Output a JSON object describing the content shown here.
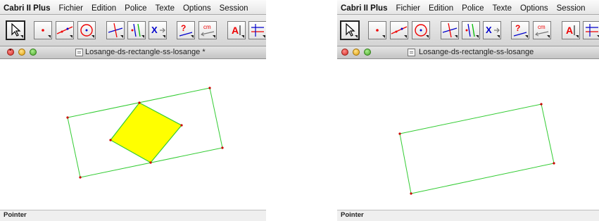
{
  "menubar": {
    "app": "Cabri II Plus",
    "left_items": [
      "Fichier",
      "Edition",
      "Police",
      "Texte",
      "Options",
      "Session"
    ],
    "right_items": [
      "Fichier",
      "Edition",
      "Police",
      "Texte",
      "Options",
      "Session"
    ]
  },
  "windows": {
    "left_title": "Losange-ds-rectangle-ss-losange *",
    "right_title": "Losange-ds-rectangle-ss-losange"
  },
  "status": {
    "left": "Pointer",
    "right": "Pointer"
  },
  "tools": [
    {
      "name": "pointer-tool-button",
      "icon": "pointer-arrow-icon"
    },
    {
      "name": "point-tool-button",
      "icon": "point-icon"
    },
    {
      "name": "line-tool-button",
      "icon": "line-icon"
    },
    {
      "name": "circle-tool-button",
      "icon": "circle-icon"
    },
    {
      "name": "perpendicular-tool-button",
      "icon": "perpendicular-lines-icon"
    },
    {
      "name": "parallel-tool-button",
      "icon": "parallel-line-icon"
    },
    {
      "name": "transformation-tool-button",
      "icon": "transformation-icon"
    },
    {
      "name": "check-property-tool-button",
      "icon": "question-mark-icon"
    },
    {
      "name": "measure-tool-button",
      "icon": "measure-cm-icon"
    },
    {
      "name": "text-tool-button",
      "icon": "text-label-icon"
    },
    {
      "name": "display-tool-button",
      "icon": "display-icon"
    }
  ],
  "colors": {
    "outline": "#33cc33",
    "fill": "#ffff00",
    "point": "#cc0000"
  }
}
